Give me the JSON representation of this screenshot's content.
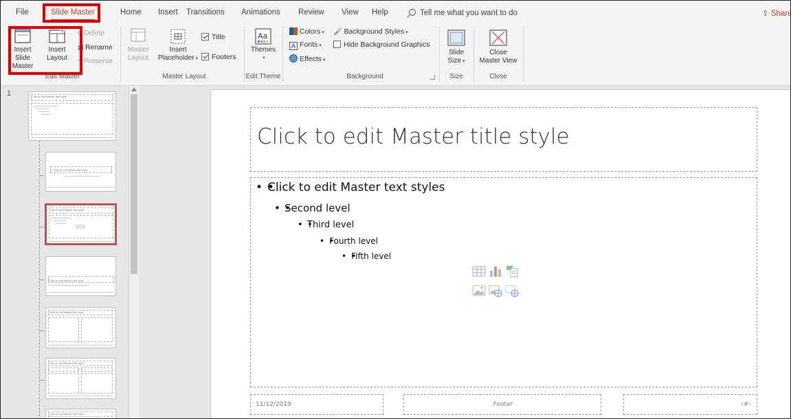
{
  "tabs": {
    "file": "File",
    "slide_master": "Slide Master",
    "home": "Home",
    "insert": "Insert",
    "transitions": "Transitions",
    "animations": "Animations",
    "review": "Review",
    "view": "View",
    "help": "Help",
    "tell_me": "Tell me what you want to do",
    "share": "Share"
  },
  "ribbon": {
    "edit_master": {
      "label": "Edit Master",
      "insert_slide_master_line1": "Insert Slide",
      "insert_slide_master_line2": "Master",
      "insert_layout_line1": "Insert",
      "insert_layout_line2": "Layout",
      "delete": "Delete",
      "rename": "Rename",
      "preserve": "Preserve"
    },
    "master_layout": {
      "label": "Master Layout",
      "master_layout_line1": "Master",
      "master_layout_line2": "Layout",
      "insert_placeholder_line1": "Insert",
      "insert_placeholder_line2": "Placeholder",
      "title": "Title",
      "footers": "Footers"
    },
    "edit_theme": {
      "label": "Edit Theme",
      "themes": "Themes"
    },
    "background": {
      "label": "Background",
      "colors": "Colors",
      "fonts": "Fonts",
      "effects": "Effects",
      "background_styles": "Background Styles",
      "hide_background_graphics": "Hide Background Graphics"
    },
    "size": {
      "label": "Size",
      "slide_size_line1": "Slide",
      "slide_size_line2": "Size"
    },
    "close": {
      "label": "Close",
      "close_master_view_line1": "Close",
      "close_master_view_line2": "Master View"
    }
  },
  "thumbnails": {
    "master_number": "1",
    "master_title": "Click to edit Master title style",
    "layout_title": "Click to edit Master title style"
  },
  "slide": {
    "title": "Click to edit Master title style",
    "level1": "Click to edit Master text styles",
    "level2": "Second level",
    "level3": "Third level",
    "level4": "Fourth level",
    "level5": "Fifth level",
    "date": "11/12/2019",
    "footer": "Footer",
    "slide_number": "‹#›"
  },
  "colors": {
    "accent": "#b7472a",
    "highlight": "#e00000",
    "selected_thumb": "#c0504d"
  },
  "icons": [
    "insert-slide-master-icon",
    "insert-layout-icon",
    "delete-icon",
    "rename-icon",
    "preserve-icon",
    "master-layout-icon",
    "insert-placeholder-icon",
    "themes-icon",
    "colors-icon",
    "fonts-icon",
    "effects-icon",
    "background-styles-icon",
    "slide-size-icon",
    "close-master-view-icon",
    "search-icon",
    "share-icon"
  ]
}
